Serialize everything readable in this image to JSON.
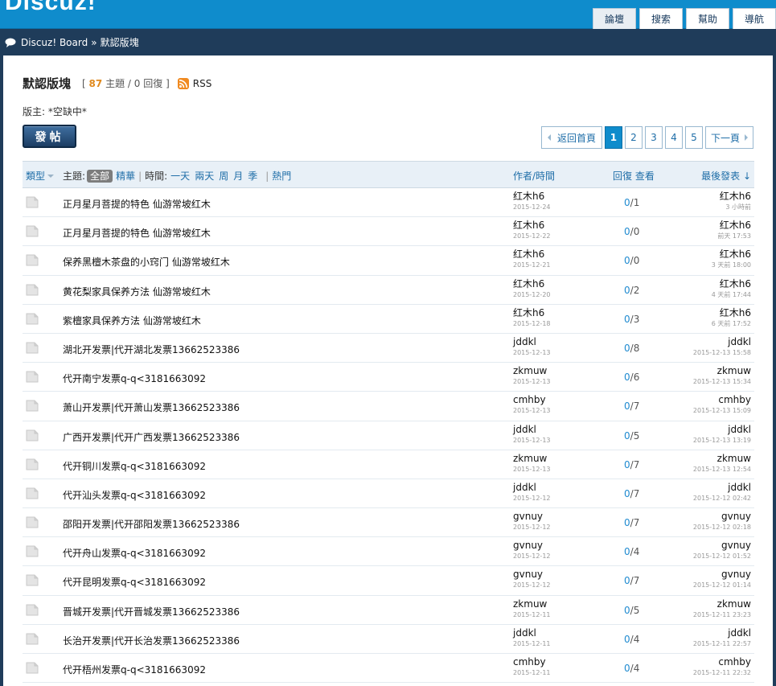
{
  "header": {
    "logo": "Discuz!",
    "nav": [
      {
        "label": "論壇",
        "active": true
      },
      {
        "label": "搜索",
        "active": false
      },
      {
        "label": "幫助",
        "active": false
      },
      {
        "label": "導航",
        "active": false
      }
    ]
  },
  "breadcrumb": {
    "icon": "speech-bubble-icon",
    "home": "Discuz! Board",
    "sep": "»",
    "current": "默認版塊"
  },
  "forum": {
    "title": "默認版塊",
    "stats_open": "[",
    "topic_count": "87",
    "topic_label": "主題 /",
    "reply_count": "0",
    "reply_label": "回復",
    "stats_close": "]",
    "rss_label": "RSS",
    "moderators": "版主: *空缺中*"
  },
  "post_button": "發帖",
  "pager": {
    "back": "返回首頁",
    "pages": [
      "1",
      "2",
      "3",
      "4",
      "5"
    ],
    "current": "1",
    "next": "下一頁"
  },
  "table_head": {
    "type": "類型",
    "filter_label": "主題:",
    "filter_all": "全部",
    "filter_digest": "精華",
    "time_sep": "|",
    "time_label": "時間:",
    "time_options": [
      "一天",
      "兩天",
      "周",
      "月",
      "季"
    ],
    "hot_sep": "|",
    "hot": "熱門",
    "author": "作者/時間",
    "stats": "回復 查看",
    "last": "最後發表 ↓"
  },
  "threads": [
    {
      "title": "正月星月菩提的特色 仙游常坡红木",
      "author": "红木h6",
      "date": "2015-12-24",
      "replies": "0",
      "views": "1",
      "last_user": "红木h6",
      "last_time": "3 小時前"
    },
    {
      "title": "正月星月菩提的特色 仙游常坡红木",
      "author": "红木h6",
      "date": "2015-12-22",
      "replies": "0",
      "views": "0",
      "last_user": "红木h6",
      "last_time": "前天 17:53"
    },
    {
      "title": "保养黑檀木茶盘的小窍门 仙游常坡红木",
      "author": "红木h6",
      "date": "2015-12-21",
      "replies": "0",
      "views": "0",
      "last_user": "红木h6",
      "last_time": "3 天前 18:00"
    },
    {
      "title": "黄花梨家具保养方法 仙游常坡红木",
      "author": "红木h6",
      "date": "2015-12-20",
      "replies": "0",
      "views": "2",
      "last_user": "红木h6",
      "last_time": "4 天前 17:44"
    },
    {
      "title": "紫檀家具保养方法 仙游常坡红木",
      "author": "红木h6",
      "date": "2015-12-18",
      "replies": "0",
      "views": "3",
      "last_user": "红木h6",
      "last_time": "6 天前 17:52"
    },
    {
      "title": "湖北开发票|代开湖北发票13662523386",
      "author": "jddkl",
      "date": "2015-12-13",
      "replies": "0",
      "views": "8",
      "last_user": "jddkl",
      "last_time": "2015-12-13 15:58"
    },
    {
      "title": "代开南宁发票q-q<3181663092",
      "author": "zkmuw",
      "date": "2015-12-13",
      "replies": "0",
      "views": "6",
      "last_user": "zkmuw",
      "last_time": "2015-12-13 15:34"
    },
    {
      "title": "萧山开发票|代开萧山发票13662523386",
      "author": "cmhby",
      "date": "2015-12-13",
      "replies": "0",
      "views": "7",
      "last_user": "cmhby",
      "last_time": "2015-12-13 15:09"
    },
    {
      "title": "广西开发票|代开广西发票13662523386",
      "author": "jddkl",
      "date": "2015-12-13",
      "replies": "0",
      "views": "5",
      "last_user": "jddkl",
      "last_time": "2015-12-13 13:19"
    },
    {
      "title": "代开铜川发票q-q<3181663092",
      "author": "zkmuw",
      "date": "2015-12-13",
      "replies": "0",
      "views": "7",
      "last_user": "zkmuw",
      "last_time": "2015-12-13 12:54"
    },
    {
      "title": "代开汕头发票q-q<3181663092",
      "author": "jddkl",
      "date": "2015-12-12",
      "replies": "0",
      "views": "7",
      "last_user": "jddkl",
      "last_time": "2015-12-12 02:42"
    },
    {
      "title": "邵阳开发票|代开邵阳发票13662523386",
      "author": "gvnuy",
      "date": "2015-12-12",
      "replies": "0",
      "views": "7",
      "last_user": "gvnuy",
      "last_time": "2015-12-12 02:18"
    },
    {
      "title": "代开舟山发票q-q<3181663092",
      "author": "gvnuy",
      "date": "2015-12-12",
      "replies": "0",
      "views": "4",
      "last_user": "gvnuy",
      "last_time": "2015-12-12 01:52"
    },
    {
      "title": "代开昆明发票q-q<3181663092",
      "author": "gvnuy",
      "date": "2015-12-12",
      "replies": "0",
      "views": "7",
      "last_user": "gvnuy",
      "last_time": "2015-12-12 01:14"
    },
    {
      "title": "晋城开发票|代开晋城发票13662523386",
      "author": "zkmuw",
      "date": "2015-12-11",
      "replies": "0",
      "views": "5",
      "last_user": "zkmuw",
      "last_time": "2015-12-11 23:23"
    },
    {
      "title": "长治开发票|代开长治发票13662523386",
      "author": "jddkl",
      "date": "2015-12-11",
      "replies": "0",
      "views": "4",
      "last_user": "jddkl",
      "last_time": "2015-12-11 22:57"
    },
    {
      "title": "代开梧州发票q-q<3181663092",
      "author": "cmhby",
      "date": "2015-12-11",
      "replies": "0",
      "views": "4",
      "last_user": "cmhby",
      "last_time": "2015-12-11 22:32"
    }
  ]
}
